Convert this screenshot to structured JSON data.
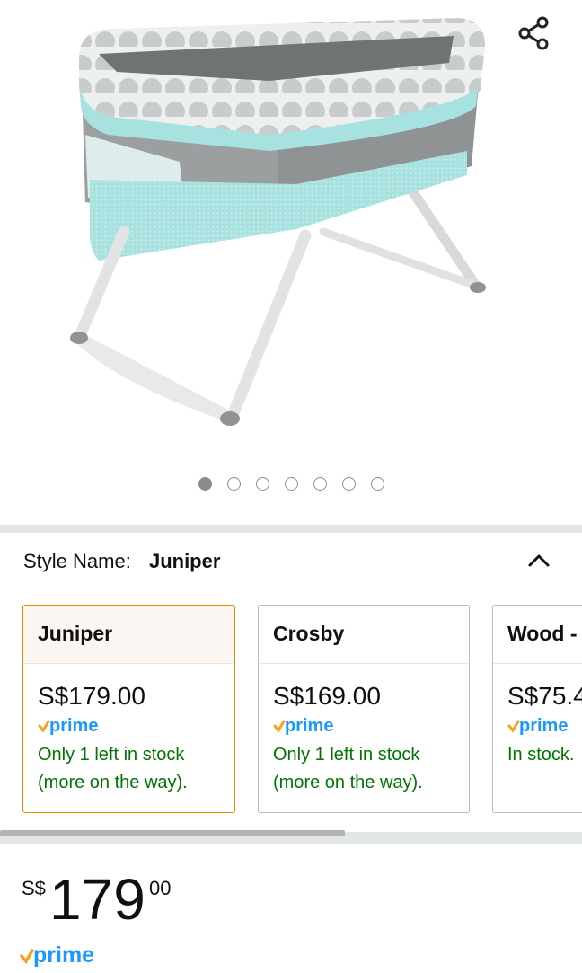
{
  "carousel": {
    "image": "baby-bassinet-product-photo",
    "page_count": 7,
    "active_index": 0,
    "share_icon": "share-icon"
  },
  "style": {
    "label": "Style Name:",
    "value": "Juniper",
    "toggle_icon": "chevron-up-icon"
  },
  "options": [
    {
      "name": "Juniper",
      "price": "S$179.00",
      "prime": "prime",
      "stock": "Only 1 left in stock (more on the way).",
      "selected": true
    },
    {
      "name": "Crosby",
      "price": "S$169.00",
      "prime": "prime",
      "stock": "Only 1 left in stock (more on the way).",
      "selected": false
    },
    {
      "name": "Wood -",
      "price": "S$75.4",
      "prime": "prime",
      "stock": "In stock.",
      "selected": false
    }
  ],
  "price": {
    "currency": "S$",
    "whole": "179",
    "fraction": "00",
    "prime": "prime"
  },
  "colors": {
    "accent": "#e68a00",
    "stock_green": "#007600",
    "prime_blue": "#1a98ff",
    "prime_check": "#f7a21b"
  }
}
